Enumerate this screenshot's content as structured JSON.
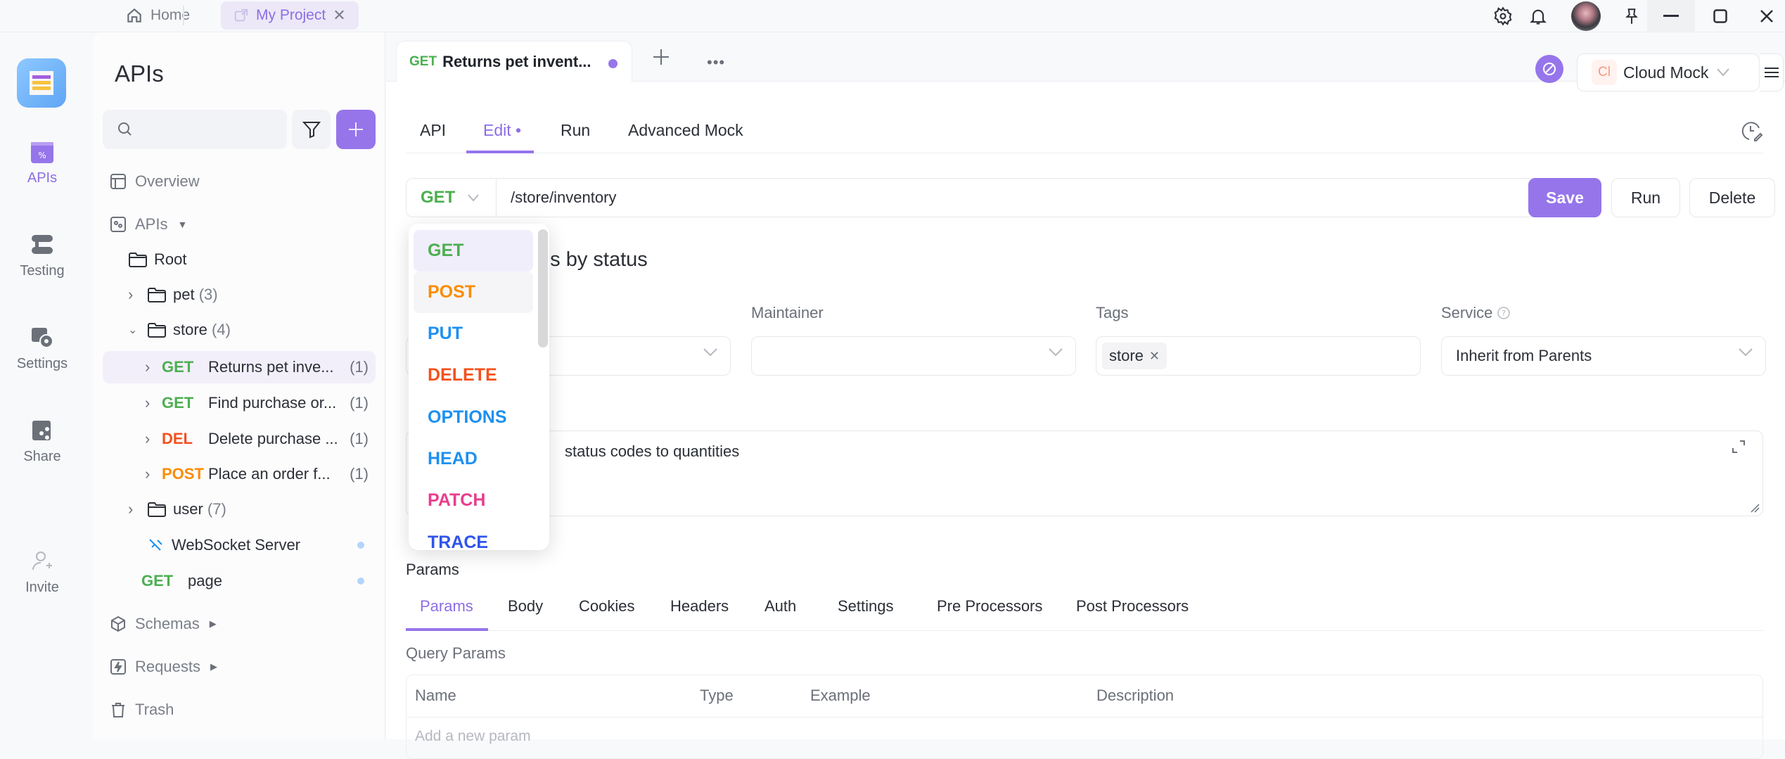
{
  "titlebar": {
    "tabs": [
      {
        "label": "Home",
        "icon": "home-icon"
      },
      {
        "label": "My Project",
        "icon": "external-link-icon",
        "active": true
      }
    ],
    "icons": [
      "gear-icon",
      "bell-icon",
      "avatar",
      "pin-icon"
    ],
    "window_controls": [
      "minimize",
      "maximize",
      "close"
    ]
  },
  "rail": {
    "items": [
      {
        "label": "APIs",
        "icon": "apis-icon",
        "active": true
      },
      {
        "label": "Testing",
        "icon": "testing-icon"
      },
      {
        "label": "Settings",
        "icon": "settings-icon"
      },
      {
        "label": "Share",
        "icon": "share-icon"
      },
      {
        "label": "Invite",
        "icon": "invite-icon"
      }
    ]
  },
  "tree": {
    "title": "APIs",
    "search_placeholder": "",
    "overview": "Overview",
    "apis_label": "APIs",
    "root": "Root",
    "folders": [
      {
        "name": "pet",
        "count": "(3)",
        "expanded": false
      },
      {
        "name": "store",
        "count": "(4)",
        "expanded": true
      },
      {
        "name": "user",
        "count": "(7)",
        "expanded": false
      }
    ],
    "store_items": [
      {
        "method": "GET",
        "name": "Returns pet inve...",
        "count": "(1)",
        "selected": true
      },
      {
        "method": "GET",
        "name": "Find purchase or...",
        "count": "(1)"
      },
      {
        "method": "DEL",
        "name": "Delete purchase ...",
        "count": "(1)"
      },
      {
        "method": "POST",
        "name": "Place an order f...",
        "count": "(1)"
      }
    ],
    "websocket": "WebSocket Server",
    "page_item": {
      "method": "GET",
      "name": "page"
    },
    "schemas": "Schemas",
    "requests": "Requests",
    "trash": "Trash"
  },
  "doc_tab": {
    "method": "GET",
    "title": "Returns pet invent...",
    "unsaved": true
  },
  "env": {
    "badge": "Cl",
    "label": "Cloud Mock"
  },
  "sub_tabs": [
    {
      "label": "API"
    },
    {
      "label": "Edit",
      "active": true,
      "dot": "•"
    },
    {
      "label": "Run"
    },
    {
      "label": "Advanced Mock"
    }
  ],
  "request": {
    "method": "GET",
    "url": "/store/inventory",
    "save": "Save",
    "run": "Run",
    "delete": "Delete"
  },
  "operation": {
    "title_visible": "ventories by status",
    "maintainer_label": "Maintainer",
    "maintainer_value": "",
    "tags_label": "Tags",
    "tags": [
      "store"
    ],
    "service_label": "Service",
    "service_value": "Inherit from Parents",
    "description_visible": "status codes to quantities"
  },
  "method_dropdown": {
    "options": [
      {
        "label": "GET",
        "color": "#4caf50",
        "selected": true
      },
      {
        "label": "POST",
        "color": "#fb8c00",
        "hover": true
      },
      {
        "label": "PUT",
        "color": "#1e90f0"
      },
      {
        "label": "DELETE",
        "color": "#f4511e"
      },
      {
        "label": "OPTIONS",
        "color": "#1e90f0"
      },
      {
        "label": "HEAD",
        "color": "#1e90f0"
      },
      {
        "label": "PATCH",
        "color": "#e83e8c"
      },
      {
        "label": "TRACE",
        "color": "#2f54eb"
      }
    ]
  },
  "params": {
    "section_label": "Params",
    "tabs": [
      "Params",
      "Body",
      "Cookies",
      "Headers",
      "Auth",
      "Settings",
      "Pre Processors",
      "Post Processors"
    ],
    "active_tab": "Params",
    "query_label": "Query Params",
    "columns": [
      "Name",
      "Type",
      "Example",
      "Description"
    ],
    "placeholder": "Add a new param"
  },
  "colors": {
    "accent": "#9675eb",
    "get": "#4caf50",
    "post": "#fb8c00",
    "delete": "#f4511e"
  }
}
